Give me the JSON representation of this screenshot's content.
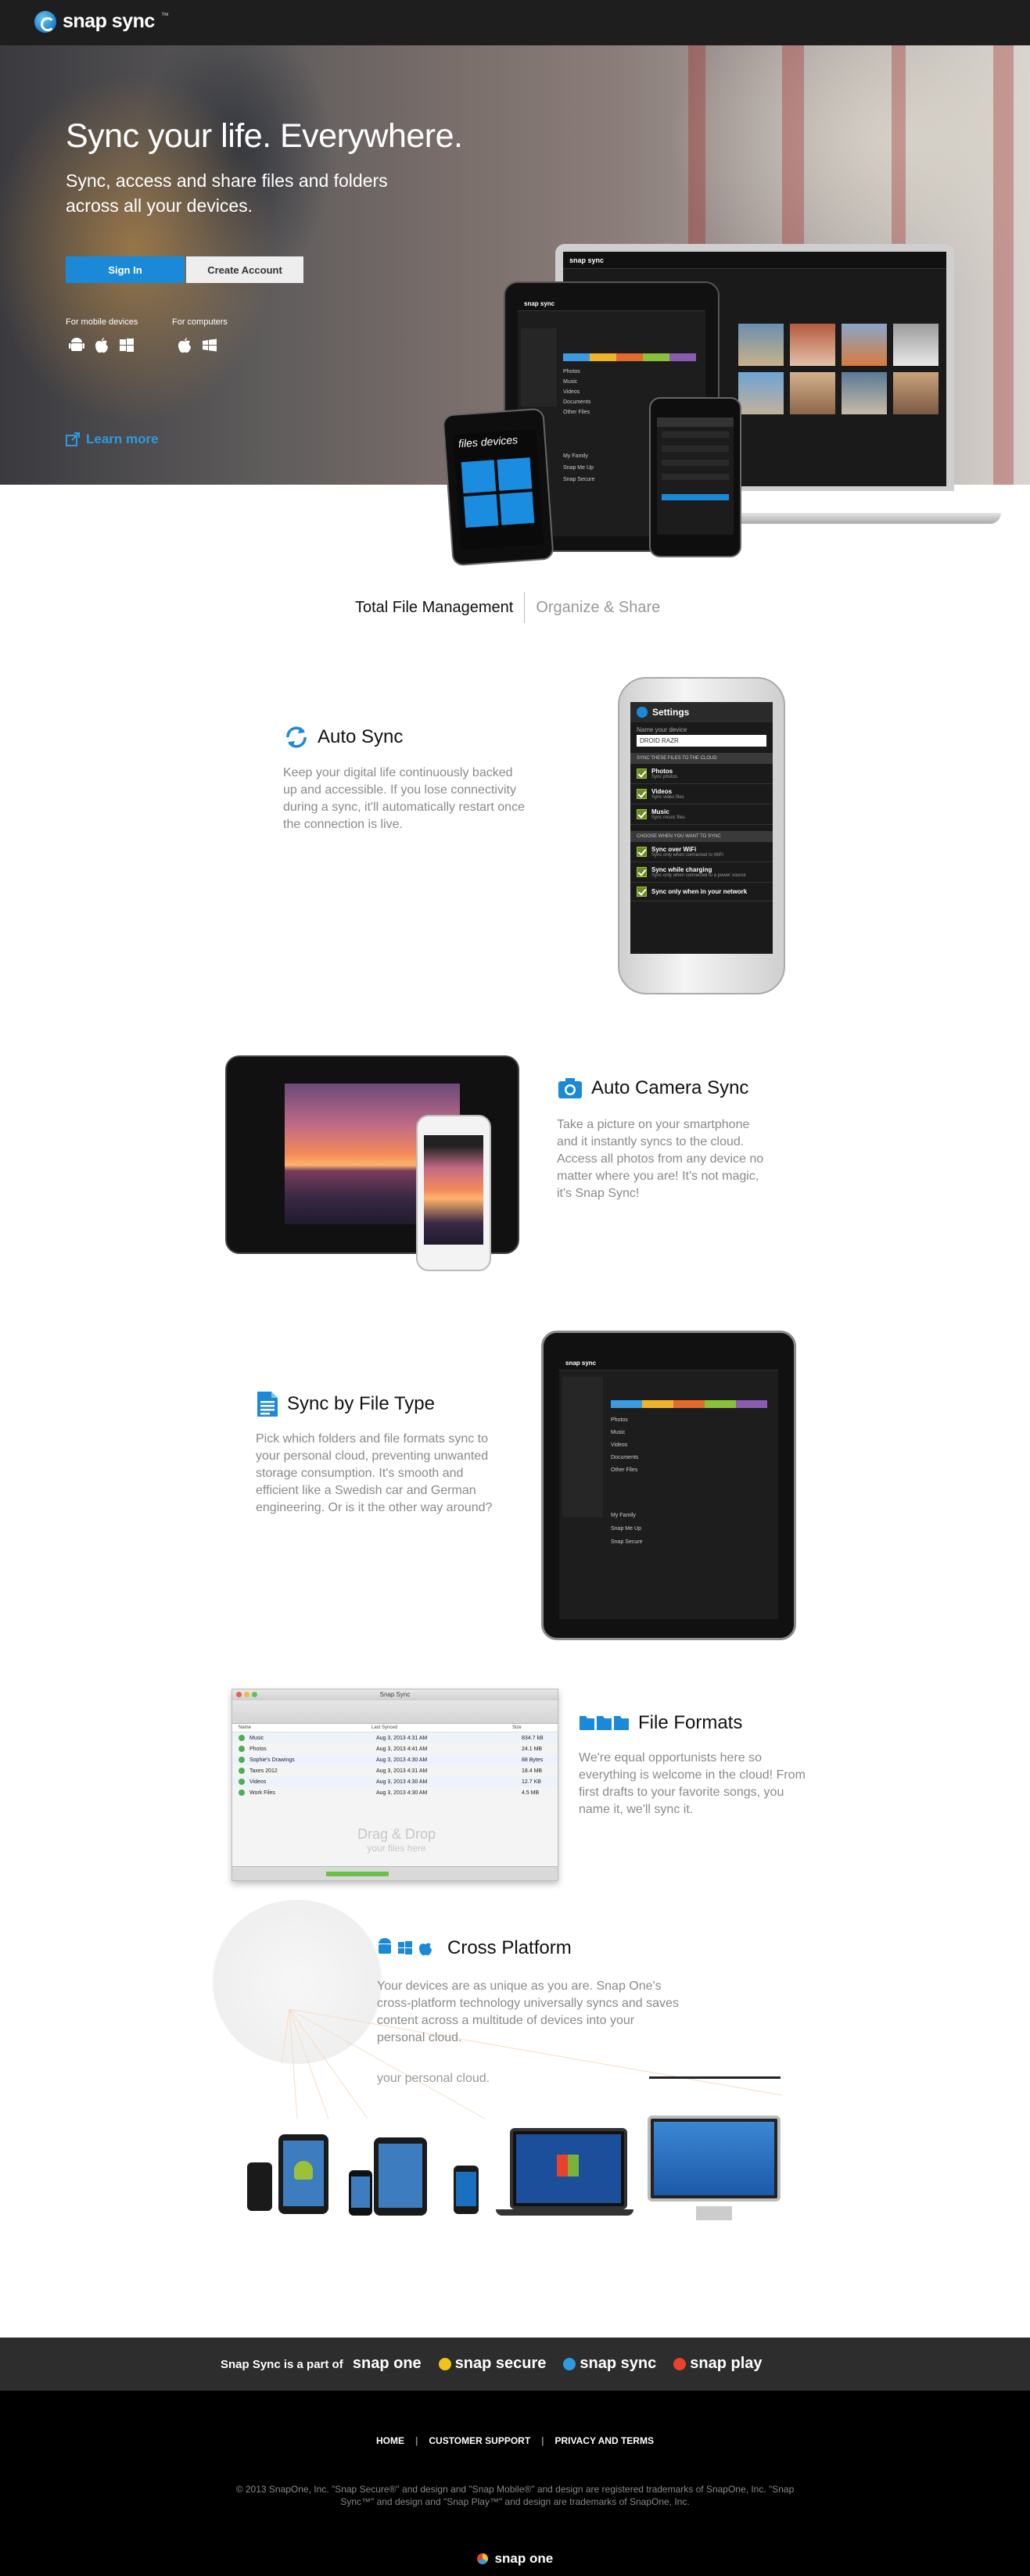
{
  "header": {
    "brand": "snap sync",
    "brand_mark": "™"
  },
  "hero": {
    "title": "Sync your life. Everywhere.",
    "subtitle": "Sync, access and share files and folders across all your devices.",
    "sign_in": "Sign In",
    "create_account": "Create Account",
    "mobile_label": "For mobile devices",
    "computers_label": "For computers",
    "learn_more": "Learn more"
  },
  "tabs": [
    {
      "label": "Total File Management",
      "active": true
    },
    {
      "label": "Organize & Share",
      "active": false
    }
  ],
  "features": {
    "auto_sync": {
      "title": "Auto Sync",
      "text": "Keep your digital life continuously backed up and accessible. If you lose connectivity during a sync, it'll automatically restart once the connection is live."
    },
    "auto_camera": {
      "title": "Auto Camera Sync",
      "text": "Take a picture on your smartphone and it instantly syncs to the cloud. Access all photos from any device no matter where you are! It's not magic, it's Snap Sync!"
    },
    "file_type": {
      "title": "Sync by File Type",
      "text": "Pick which folders and file formats sync to your personal cloud, preventing unwanted storage consumption. It's smooth and efficient like a Swedish car and German engineering. Or is it the other way around?"
    },
    "file_formats": {
      "title": "File Formats",
      "text": "We're equal opportunists here so everything is welcome in the cloud! From first drafts to your favorite songs, you name it, we'll sync it."
    },
    "cross_platform": {
      "title": "Cross Platform",
      "text": "Your devices are as unique as you are. Snap One's cross-platform technology universally syncs and saves content across a multitude of devices into your personal cloud.",
      "ghost_text": "your personal cloud."
    }
  },
  "settings_phone": {
    "title": "Settings",
    "name_label": "Name your device",
    "name_value": "DROID RAZR",
    "section1": "SYNC THESE FILES TO THE CLOUD",
    "rows": [
      {
        "title": "Photos",
        "sub": "Sync photos"
      },
      {
        "title": "Videos",
        "sub": "Sync video files"
      },
      {
        "title": "Music",
        "sub": "Sync music files"
      }
    ],
    "section2": "CHOOSE WHEN YOU WANT TO SYNC",
    "rows2": [
      {
        "title": "Sync over WiFi",
        "sub": "Sync only when connected to WiFi"
      },
      {
        "title": "Sync while charging",
        "sub": "Sync only when connected to a power source"
      },
      {
        "title": "Sync only when in your network",
        "sub": ""
      }
    ]
  },
  "mac_window": {
    "title": "Snap Sync",
    "columns": [
      "Name",
      "Last Synced",
      "Size"
    ],
    "rows": [
      {
        "name": "Music",
        "date": "Aug 3, 2013 4:31 AM",
        "size": "834.7 kB"
      },
      {
        "name": "Photos",
        "date": "Aug 3, 2013 4:41 AM",
        "size": "24.1 MB"
      },
      {
        "name": "Sophie's Drawings",
        "date": "Aug 3, 2013 4:30 AM",
        "size": "88 Bytes"
      },
      {
        "name": "Taxes 2012",
        "date": "Aug 3, 2013 4:31 AM",
        "size": "18.4 MB"
      },
      {
        "name": "Videos",
        "date": "Aug 3, 2013 4:30 AM",
        "size": "12.7 KB"
      },
      {
        "name": "Work Files",
        "date": "Aug 3, 2013 4:30 AM",
        "size": "4.5 MB"
      }
    ],
    "drop_line1": "Drag & Drop",
    "drop_line2": "your files here"
  },
  "hero_app": {
    "folders": [
      "Photos",
      "Music",
      "Videos",
      "Documents",
      "Other Files"
    ],
    "contacts": [
      "My Family",
      "Snap Me Up",
      "Snap Secure"
    ]
  },
  "partner_bar": {
    "lead": "Snap Sync is a part of",
    "parent": "snap one",
    "brands": [
      {
        "name": "snap secure",
        "color": "#f0c419"
      },
      {
        "name": "snap sync",
        "color": "#2d9be0"
      },
      {
        "name": "snap play",
        "color": "#e8412e"
      }
    ]
  },
  "footer": {
    "nav": [
      "HOME",
      "CUSTOMER SUPPORT",
      "PRIVACY AND TERMS"
    ],
    "legal": "© 2013 SnapOne, Inc. \"Snap Secure®\" and design and \"Snap Mobile®\" and design are registered trademarks of SnapOne, Inc. \"Snap Sync™\" and design and \"Snap Play™\" and design are trademarks of SnapOne, Inc.",
    "logo": "snap one"
  },
  "colors": {
    "accent": "#1a8ad8",
    "topbar": "#1e1e1f",
    "footer": "#000000"
  }
}
